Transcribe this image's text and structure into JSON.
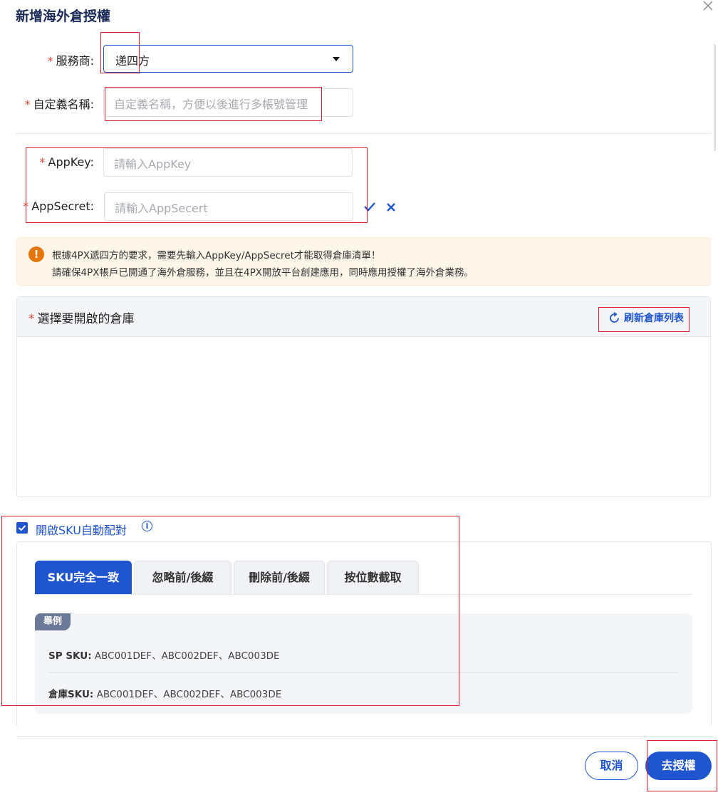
{
  "dialog": {
    "title": "新增海外倉授權",
    "close_icon": "close-icon"
  },
  "form": {
    "provider": {
      "label": "服務商:",
      "required_mark": "*",
      "value": "递四方"
    },
    "custom_name": {
      "label": "自定義名稱:",
      "required_mark": "*",
      "placeholder": "自定義名稱，方便以後進行多帳號管理"
    },
    "app_key": {
      "label": "AppKey:",
      "required_mark": "*",
      "placeholder": "請輸入AppKey"
    },
    "app_secret": {
      "label": "AppSecret:",
      "required_mark": "*",
      "placeholder": "請輸入AppSecert",
      "confirm_icon": "check-icon",
      "cancel_icon": "close-icon"
    }
  },
  "alert": {
    "icon": "exclamation-icon",
    "line1": "根據4PX遞四方的要求，需要先輸入AppKey/AppSecret才能取得倉庫清單！",
    "line2": "請確保4PX帳戶已開通了海外倉服務，並且在4PX開放平台創建應用，同時應用授權了海外倉業務。"
  },
  "warehouse": {
    "required_mark": "*",
    "title": "選擇要開啟的倉庫",
    "refresh_label": "刷新倉庫列表"
  },
  "sku_match": {
    "checked": true,
    "label": "開啟SKU自動配對",
    "tabs": [
      "SKU完全一致",
      "忽略前/後綴",
      "刪除前/後綴",
      "按位數截取"
    ],
    "active_tab": 0,
    "example": {
      "badge": "舉例",
      "sp_label": "SP SKU:",
      "sp_value": "ABC001DEF、ABC002DEF、ABC003DE",
      "wh_label": "倉庫SKU:",
      "wh_value": "ABC001DEF、ABC002DEF、ABC003DE"
    }
  },
  "footer": {
    "cancel_label": "取消",
    "submit_label": "去授權"
  },
  "colors": {
    "primary": "#1f56d0",
    "required": "#e0493a",
    "warning": "#e6750c",
    "annotation": "#e0202a"
  }
}
